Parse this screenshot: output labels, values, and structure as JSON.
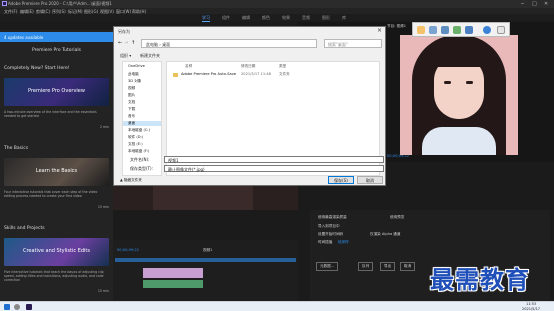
{
  "window": {
    "title": "Adobe Premiere Pro 2020 - C:\\用户\\Adm...\\桌面\\视频1",
    "controls": [
      "─",
      "□",
      "✕"
    ]
  },
  "menu": [
    "文件(F)",
    "编辑(E)",
    "剪辑(C)",
    "序列(S)",
    "标记(M)",
    "图形(G)",
    "视图(V)",
    "窗口(W)",
    "帮助(H)"
  ],
  "workspaces": [
    "学习",
    "组件",
    "编辑",
    "颜色",
    "效果",
    "音频",
    "图形",
    "库"
  ],
  "learn": {
    "updates_label": "4 updates available",
    "heading": "Premiere Pro Tutorials",
    "sections": [
      {
        "title": "Completely New? Start Here!",
        "card": "Premiere Pro Overview",
        "desc": "A two-minute overview of the interface and the essentials needed to get started",
        "duration": "2 min"
      },
      {
        "title": "The Basics",
        "card": "Learn the Basics",
        "desc": "Four interactive tutorials that cover each step of the video editing process needed to create your first video",
        "duration": "15 min"
      },
      {
        "title": "Skills and Projects",
        "card": "Creative and Stylistic Edits",
        "desc": "Five interactive tutorials that teach the basics of adjusting clip speed, adding titles and transitions, adjusting audio, and color correction",
        "duration": "15 min"
      }
    ]
  },
  "dialog": {
    "title": "另存为",
    "path": [
      "此电脑",
      "桌面"
    ],
    "search_placeholder": "搜索\"桌面\"",
    "commands": [
      "组织 ▾",
      "新建文件夹"
    ],
    "nav_items": [
      "OneDrive",
      "此电脑",
      "3D 对象",
      "视频",
      "图片",
      "文档",
      "下载",
      "音乐",
      "桌面",
      "本地磁盘 (C:)",
      "软件 (D:)",
      "文档 (E:)",
      "本地磁盘 (F:)"
    ],
    "nav_selected": "桌面",
    "columns": [
      "名称",
      "修改日期",
      "类型"
    ],
    "files": [
      {
        "name": "Adobe Premiere Pro Auto-Save",
        "date": "2021/5/17 11:48",
        "type": "文件夹"
      }
    ],
    "filename_label": "文件名(N):",
    "filename_value": "视频1",
    "filetype_label": "保存类型(T):",
    "filetype_value": "静止图像文件(*.jpg)",
    "hide_folders": "▲ 隐藏文件夹",
    "save_label": "保存(S)",
    "cancel_label": "取消"
  },
  "program_monitor": {
    "timecode": "00;00;09;22",
    "tabs": [
      "节目: 视频1"
    ]
  },
  "export_panel": {
    "options": [
      "导入到项目中",
      "使用最高渲染质量",
      "使用预览",
      "设置开始时间码",
      "仅渲染 Alpha 通道"
    ],
    "interp_label": "时间插值",
    "interp_value": "帧采样",
    "buttons": [
      "元数据...",
      "队列",
      "导出",
      "取消"
    ]
  },
  "timeline": {
    "timecode": "00;00;09;22",
    "tabs": [
      "视频1",
      "章节"
    ]
  },
  "watermark": "最需教育",
  "taskbar": {
    "time": "11:53",
    "date": "2021/5/17"
  },
  "colors": {
    "accent": "#2d8ceb",
    "dialog_bg": "#f0f0f0",
    "watermark": "#1f4fb8"
  }
}
